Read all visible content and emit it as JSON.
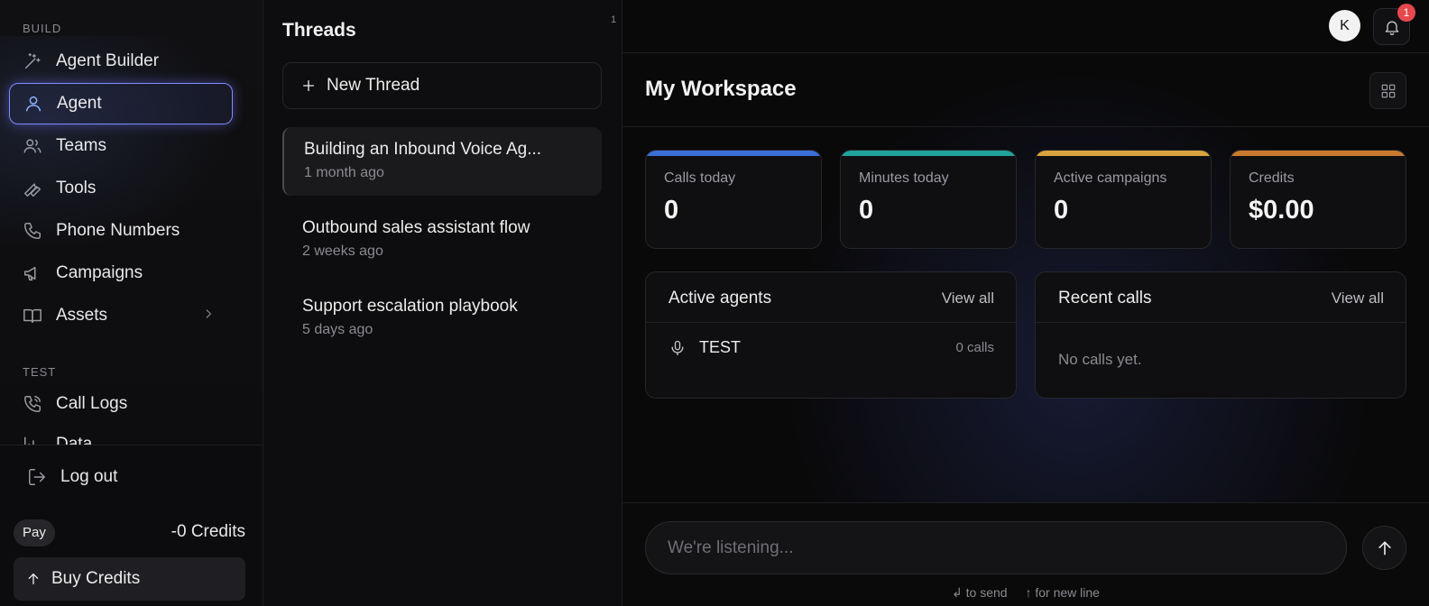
{
  "sidebar": {
    "sections": [
      {
        "label": "BUILD"
      },
      {
        "label": "TEST"
      }
    ],
    "items": [
      {
        "label": "Agent Builder",
        "icon": "wand-icon"
      },
      {
        "label": "Agent",
        "icon": "user-icon",
        "active": true
      },
      {
        "label": "Teams",
        "icon": "users-icon"
      },
      {
        "label": "Tools",
        "icon": "wrench-icon"
      },
      {
        "label": "Phone Numbers",
        "icon": "phone-icon"
      },
      {
        "label": "Campaigns",
        "icon": "megaphone-icon"
      },
      {
        "label": "Assets",
        "icon": "book-icon"
      },
      {
        "label": "Call Logs",
        "icon": "phone-call-icon"
      },
      {
        "label": "Data",
        "icon": "chart-icon"
      }
    ],
    "footer": {
      "logout_label": "Log out",
      "pay_label": "Pay",
      "credits_label": "-0 Credits",
      "buy_label": "Buy Credits"
    }
  },
  "threads": {
    "title": "Threads",
    "count": "1",
    "new_thread_label": "New Thread",
    "items": [
      {
        "title": "Building an Inbound Voice Ag...",
        "time": "1 month ago",
        "selected": true
      },
      {
        "title": "Outbound sales assistant flow",
        "time": "2 weeks ago"
      },
      {
        "title": "Support escalation playbook",
        "time": "5 days ago"
      }
    ]
  },
  "topbar": {
    "avatar_initial": "K",
    "notification_count": "1"
  },
  "workspace": {
    "title": "My Workspace",
    "stats": [
      {
        "label": "Calls today",
        "value": "0",
        "color": "#3b6fd8"
      },
      {
        "label": "Minutes today",
        "value": "0",
        "color": "#1fa39a"
      },
      {
        "label": "Active campaigns",
        "value": "0",
        "color": "#d9a23f"
      },
      {
        "label": "Credits",
        "value": "$0.00",
        "color": "#c97a2e"
      }
    ],
    "active_agents": {
      "title": "Active agents",
      "link": "View all",
      "rows": [
        {
          "name": "TEST",
          "calls": "0 calls"
        }
      ]
    },
    "recent_calls": {
      "title": "Recent calls",
      "link": "View all",
      "empty": "No calls yet."
    }
  },
  "composer": {
    "placeholder": "We're listening...",
    "hint_send": "↲ to send",
    "hint_newline": "↑ for new line"
  }
}
